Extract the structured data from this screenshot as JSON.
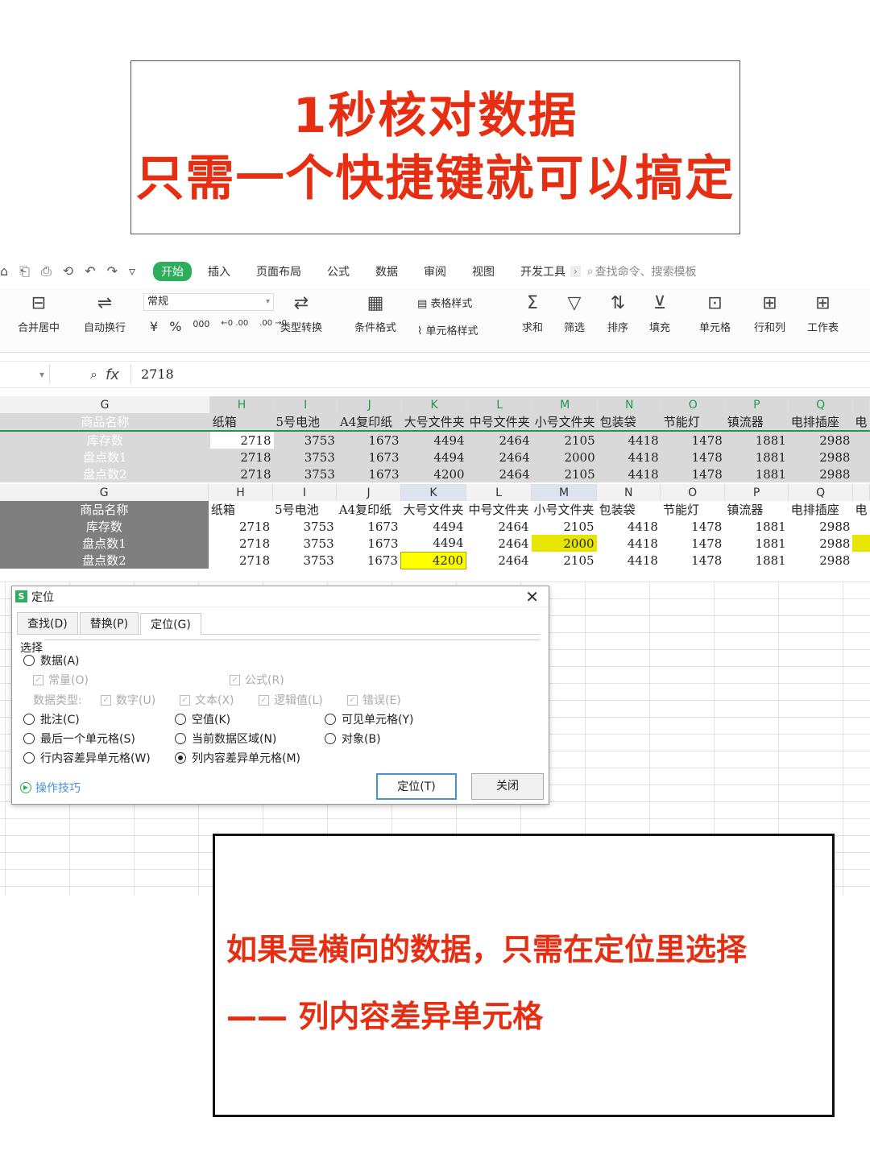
{
  "title": {
    "line1": "1秒核对数据",
    "line2": "只需一个快捷键就可以搞定"
  },
  "quick_access": [
    "⌂",
    "⎗",
    "⎙",
    "⟲",
    "↶",
    "↷",
    "▿"
  ],
  "menu": {
    "tabs": [
      "开始",
      "插入",
      "页面布局",
      "公式",
      "数据",
      "审阅",
      "视图",
      "开发工具"
    ],
    "more": "›",
    "search_placeholder": "查找命令、搜索模板"
  },
  "ribbon": {
    "merge": "合并居中",
    "wrap": "自动换行",
    "format_value": "常规",
    "currency": "¥",
    "percent": "%",
    "thousands": "000",
    "inc_dec": "←0 .00",
    "dec_dec": ".00 →0",
    "type_convert": "类型转换",
    "cond_format": "条件格式",
    "table_style": "表格样式",
    "cell_style": "单元格样式",
    "sum": "求和",
    "filter": "筛选",
    "sort": "排序",
    "fill": "填充",
    "cell": "单元格",
    "rowcol": "行和列",
    "sheet": "工作表"
  },
  "formula_bar": {
    "fx": "fx",
    "value": "2718"
  },
  "grid": {
    "columns": [
      "G",
      "H",
      "I",
      "J",
      "K",
      "L",
      "M",
      "N",
      "O",
      "P",
      "Q"
    ],
    "headers": [
      "商品名称",
      "纸箱",
      "5号电池",
      "A4复印纸",
      "大号文件夹",
      "中号文件夹",
      "小号文件夹",
      "包装袋",
      "节能灯",
      "镇流器",
      "电排插座"
    ],
    "rows": [
      {
        "name": "库存数",
        "values": [
          "2718",
          "3753",
          "1673",
          "4494",
          "2464",
          "2105",
          "4418",
          "1478",
          "1881",
          "2988"
        ]
      },
      {
        "name": "盘点数1",
        "values": [
          "2718",
          "3753",
          "1673",
          "4494",
          "2464",
          "2000",
          "4418",
          "1478",
          "1881",
          "2988"
        ]
      },
      {
        "name": "盘点数2",
        "values": [
          "2718",
          "3753",
          "1673",
          "4200",
          "2464",
          "2105",
          "4418",
          "1478",
          "1881",
          "2988"
        ]
      }
    ],
    "overflow_text": "电"
  },
  "dialog": {
    "title": "定位",
    "tabs": [
      "查找(D)",
      "替换(P)",
      "定位(G)"
    ],
    "section": "选择",
    "data": "数据(A)",
    "constant": "常量(O)",
    "formula": "公式(R)",
    "data_type_label": "数据类型:",
    "number": "数字(U)",
    "text": "文本(X)",
    "logical": "逻辑值(L)",
    "error": "错误(E)",
    "comment": "批注(C)",
    "blank": "空值(K)",
    "visible": "可见单元格(Y)",
    "last_cell": "最后一个单元格(S)",
    "current_region": "当前数据区域(N)",
    "object": "对象(B)",
    "row_diff": "行内容差异单元格(W)",
    "col_diff": "列内容差异单元格(M)",
    "tips": "操作技巧",
    "locate_btn": "定位(T)",
    "close_btn": "关闭"
  },
  "bottom": {
    "line1": "如果是横向的数据，只需在定位里选择",
    "line2": "—— 列内容差异单元格"
  }
}
